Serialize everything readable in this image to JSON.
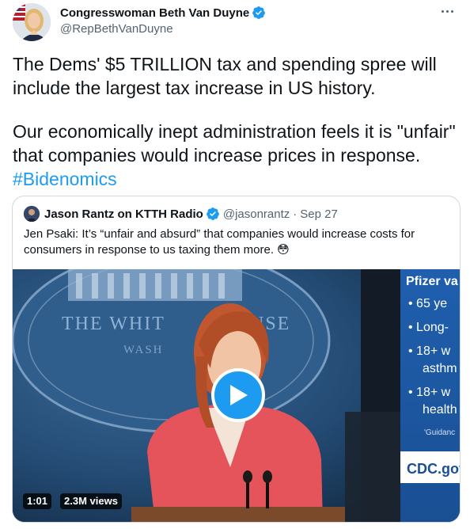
{
  "tweet": {
    "author_name": "Congresswoman Beth Van Duyne",
    "author_handle": "@RepBethVanDuyne",
    "verified": true,
    "paragraph_1": "The Dems' $5 TRILLION tax and spending spree will include the largest tax increase in US history.",
    "paragraph_2_text": "Our economically inept administration feels it is \"unfair\" that companies would increase prices in response. ",
    "paragraph_2_hashtag": "#Bidenomics",
    "more_icon": "more-horizontal-icon"
  },
  "quote": {
    "author_name": "Jason Rantz on KTTH Radio",
    "author_handle": "@jasonrantz",
    "separator": "·",
    "date": "Sep 27",
    "verified": true,
    "text": "Jen Psaki: It’s “unfair and absurd” that companies would increase costs for consumers in response to us taxing them more. 😳",
    "video": {
      "duration": "1:01",
      "views": "2.3M views",
      "screen_lines": {
        "title": "Pfizer va",
        "bullet_1": "• 65 ye",
        "bullet_2": "• Long-",
        "bullet_3a": "• 18+ w",
        "bullet_3b": "asthm",
        "bullet_4a": "• 18+ w",
        "bullet_4b": "health",
        "note": "'Guidanc",
        "source": "CDC.gov"
      },
      "backdrop_text_1": "THE WHIT",
      "backdrop_text_2": "USE",
      "backdrop_text_3": "WASH"
    }
  },
  "colors": {
    "accent": "#1d9bf0",
    "text_primary": "#0f1419",
    "text_secondary": "#536471",
    "border": "#cfd9de"
  }
}
